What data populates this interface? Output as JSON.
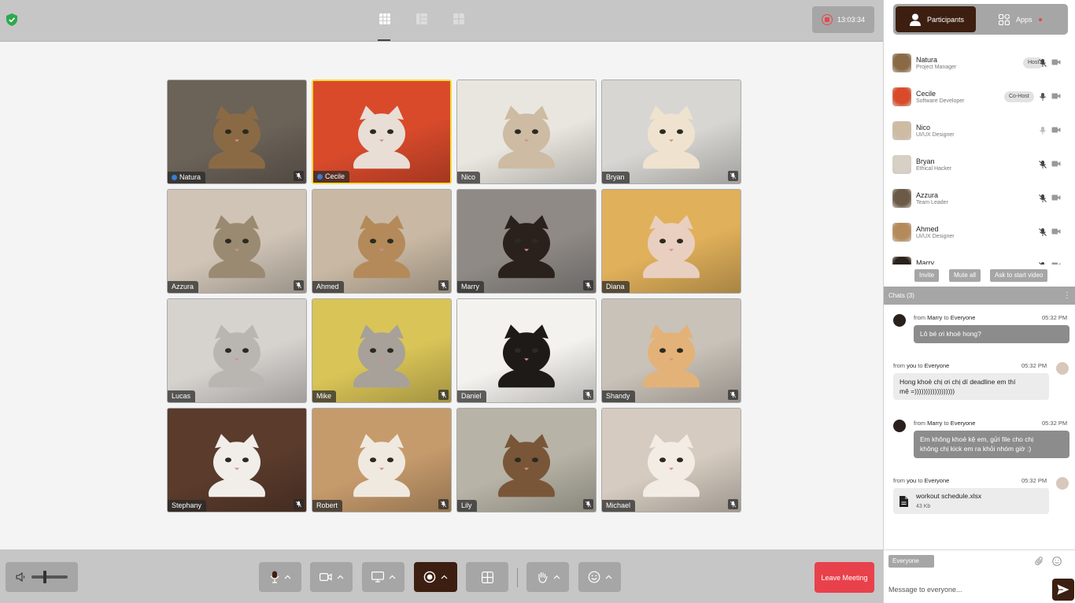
{
  "topbar": {
    "layouts": [
      "grid-layout-icon",
      "sidebar-layout-icon",
      "tiles-layout-icon"
    ],
    "recording_time": "13:03:34"
  },
  "tiles": [
    {
      "name": "Natura",
      "dot": true,
      "muted": true,
      "bg": "#6b6258",
      "fur": "#8a6a45"
    },
    {
      "name": "Cecile",
      "dot": true,
      "muted": false,
      "speaking": true,
      "bg": "#d94a2b",
      "fur": "#e8ded6"
    },
    {
      "name": "Nico",
      "dot": false,
      "muted": false,
      "bg": "#e9e6df",
      "fur": "#cdbba3"
    },
    {
      "name": "Bryan",
      "dot": false,
      "muted": true,
      "bg": "#d8d6d2",
      "fur": "#efe3cf"
    },
    {
      "name": "Azzura",
      "dot": false,
      "muted": true,
      "bg": "#cfc4b6",
      "fur": "#9a8a72"
    },
    {
      "name": "Ahmed",
      "dot": false,
      "muted": true,
      "bg": "#c9b9a4",
      "fur": "#b48a5a"
    },
    {
      "name": "Marry",
      "dot": false,
      "muted": true,
      "bg": "#8f8a86",
      "fur": "#2a211c"
    },
    {
      "name": "Diana",
      "dot": false,
      "muted": false,
      "bg": "#e0b05a",
      "fur": "#e9cfc0"
    },
    {
      "name": "Lucas",
      "dot": false,
      "muted": false,
      "bg": "#d6d3cf",
      "fur": "#b9b6b2"
    },
    {
      "name": "Mike",
      "dot": false,
      "muted": true,
      "bg": "#d9c457",
      "fur": "#a7a19a"
    },
    {
      "name": "Daniel",
      "dot": false,
      "muted": true,
      "bg": "#f3f2ee",
      "fur": "#1d1a18"
    },
    {
      "name": "Shandy",
      "dot": false,
      "muted": true,
      "bg": "#c9c2b8",
      "fur": "#e3b278"
    },
    {
      "name": "Stephany",
      "dot": false,
      "muted": true,
      "bg": "#5a3b2c",
      "fur": "#f1eeea"
    },
    {
      "name": "Robert",
      "dot": false,
      "muted": true,
      "bg": "#c69b6c",
      "fur": "#f0e9e0"
    },
    {
      "name": "Lily",
      "dot": false,
      "muted": true,
      "bg": "#b7b3a6",
      "fur": "#7a5638"
    },
    {
      "name": "Michael",
      "dot": false,
      "muted": true,
      "bg": "#d5cbc0",
      "fur": "#f3ece5"
    }
  ],
  "controls": {
    "leave_label": "Leave Meeting",
    "volume_level": 0.35
  },
  "panel": {
    "tabs": [
      {
        "label": "Participants"
      },
      {
        "label": "Apps"
      }
    ],
    "participants": [
      {
        "name": "Natura",
        "role": "Project Manager",
        "badge": "Host",
        "mic_muted": true,
        "color": "#8a6a45"
      },
      {
        "name": "Cecile",
        "role": "Software Developer",
        "badge": "Co-Host",
        "mic_muted": false,
        "color": "#d94a2b"
      },
      {
        "name": "Nico",
        "role": "UI/UX Designer",
        "badge": "",
        "mic_muted": false,
        "mic_dim": true,
        "color": "#cdbba3"
      },
      {
        "name": "Bryan",
        "role": "Ethical Hacker",
        "badge": "",
        "mic_muted": true,
        "color": "#d8d0c4"
      },
      {
        "name": "Azzura",
        "role": "Team Leader",
        "badge": "",
        "mic_muted": true,
        "color": "#6b5a46"
      },
      {
        "name": "Ahmed",
        "role": "UI/UX Designer",
        "badge": "",
        "mic_muted": true,
        "color": "#b48a5a"
      },
      {
        "name": "Marry",
        "role": "",
        "badge": "",
        "mic_muted": true,
        "color": "#2a211c"
      }
    ],
    "actions": {
      "invite": "Invite",
      "mute_all": "Mute all",
      "ask_video": "Ask to start video"
    },
    "chat": {
      "header": "Chats (3)",
      "messages": [
        {
          "from_prefix": "from",
          "from": "Marry",
          "to_prefix": "to",
          "to": "Everyone",
          "time": "05:32 PM",
          "text": "Lô bé ơi khoẻ hong?"
        },
        {
          "from_prefix": "from",
          "from": "you",
          "to_prefix": "to",
          "to": "Everyone",
          "time": "05:32 PM",
          "text_line1": "Hong khoẻ chị ơi chị dí deadline em thí",
          "text_line2": "mệ =))))))))))))))))))"
        },
        {
          "from_prefix": "from",
          "from": "Marry",
          "to_prefix": "to",
          "to": "Everyone",
          "time": "05:32 PM",
          "text_line1": "Em không khoẻ kệ em, gửi file cho chị",
          "text_line2": "không chị kick em ra khỏi nhóm giờ :)"
        },
        {
          "from_prefix": "from",
          "from": "you",
          "to_prefix": "to",
          "to": "Everyone",
          "time": "05:32 PM",
          "file_name": "workout schedule.xlsx",
          "file_size": "43 Kb"
        }
      ]
    },
    "compose": {
      "to": "Everyone",
      "placeholder": "Message to everyone..."
    }
  }
}
